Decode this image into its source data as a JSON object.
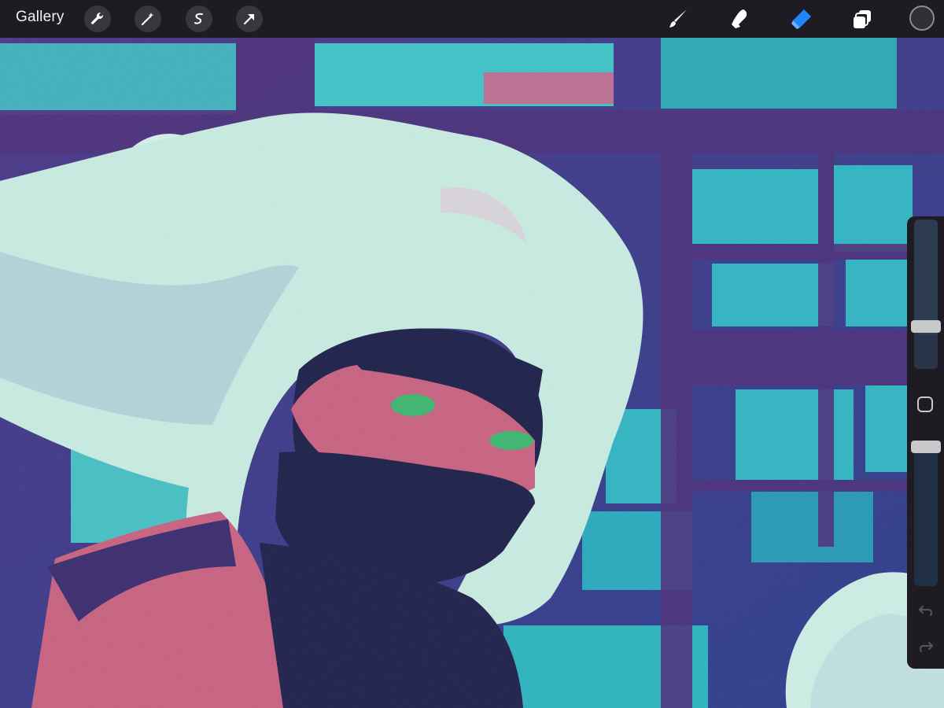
{
  "toolbar": {
    "gallery_label": "Gallery",
    "left_tools": [
      "wrench-icon",
      "magic-wand-icon",
      "selection-icon",
      "transform-arrow-icon"
    ],
    "right_tools": [
      "brush-icon",
      "smudge-icon",
      "eraser-icon",
      "layers-icon"
    ],
    "active_tool": "eraser",
    "active_color": "#322e36",
    "accent_color": "#1f86ff"
  },
  "sidebar": {
    "size_slider_level": 0.23,
    "opacity_slider_level": 1.0
  },
  "colors": {
    "ui_background": "#1f1b22",
    "artwork_background": "#2c3f86",
    "window_teal": "#2ab7c4",
    "hair": "#c9efe4",
    "skin": "#c86484",
    "shadow": "#1c1f4a"
  }
}
